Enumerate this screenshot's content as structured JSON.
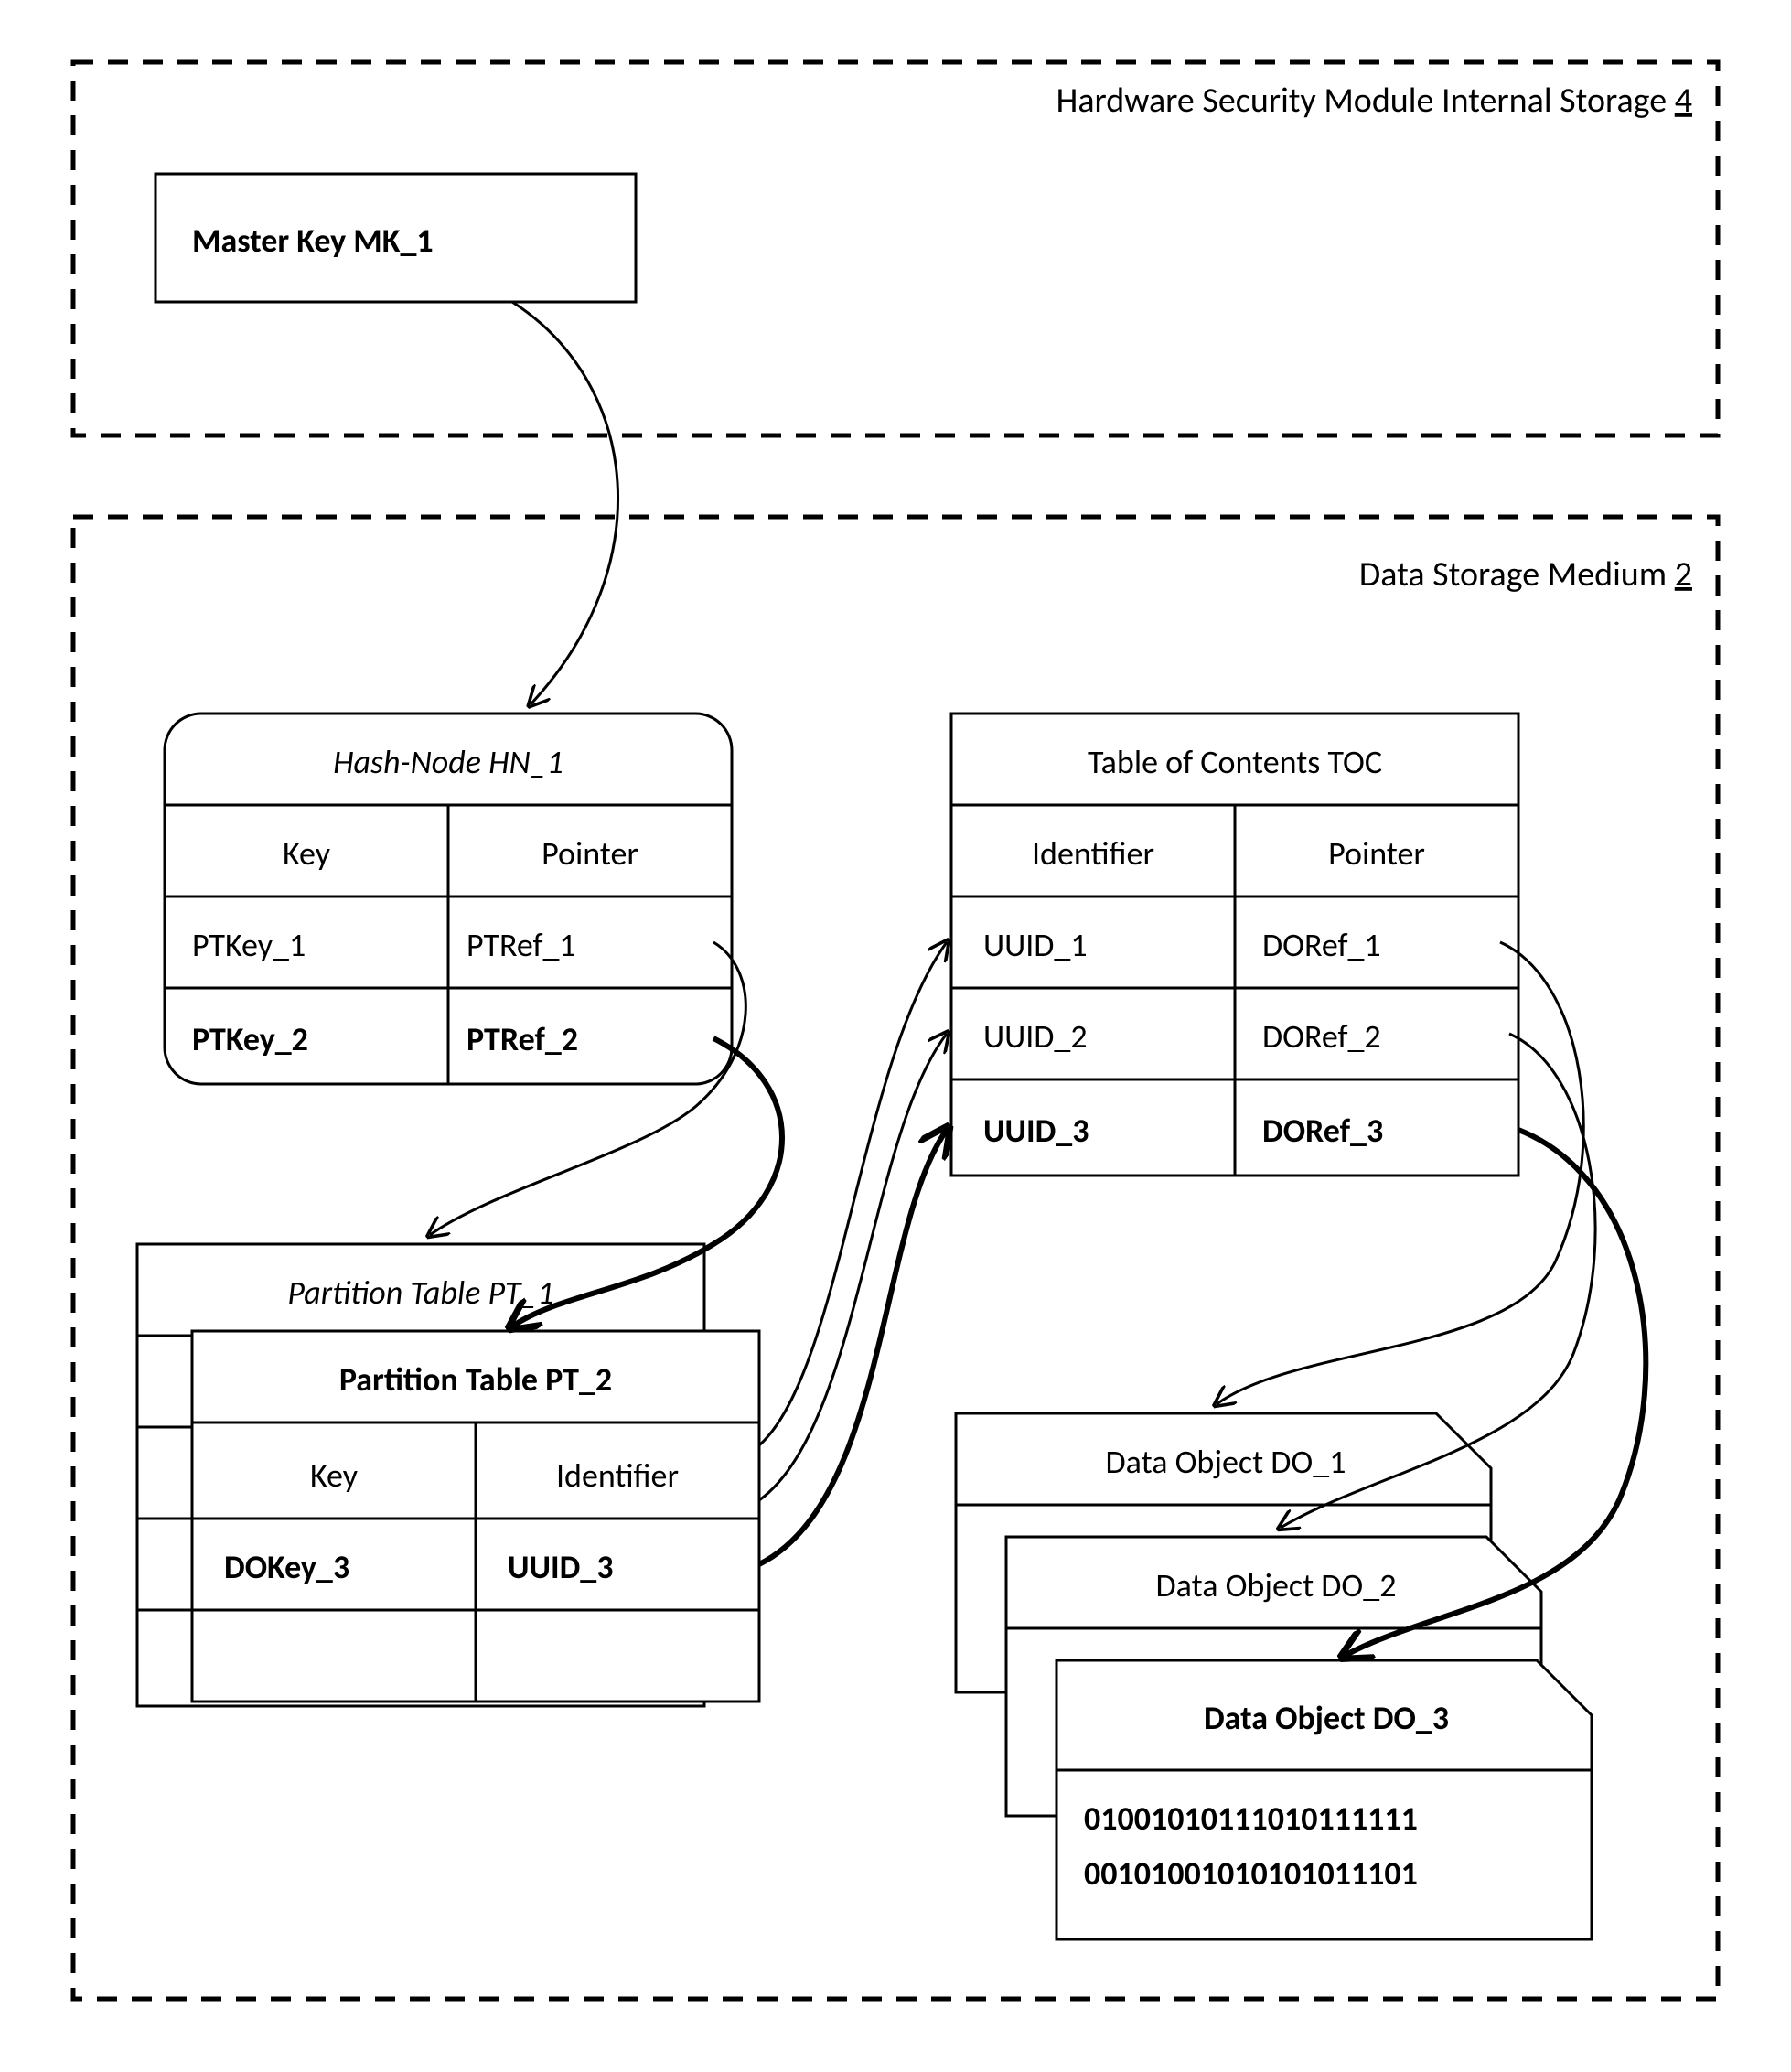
{
  "hsm": {
    "title_pre": "Hardware Security Module Internal Storage ",
    "title_num": "4",
    "master_key": "Master Key MK_1"
  },
  "dsm": {
    "title_pre": "Data Storage Medium ",
    "title_num": "2"
  },
  "hash_node": {
    "title": "Hash-Node HN_1",
    "col_key": "Key",
    "col_ptr": "Pointer",
    "rows": [
      {
        "key": "PTKey_1",
        "ptr": "PTRef_1",
        "bold": false
      },
      {
        "key": "PTKey_2",
        "ptr": "PTRef_2",
        "bold": true
      }
    ]
  },
  "toc": {
    "title": "Table of Contents TOC",
    "col_id": "Identifier",
    "col_ptr": "Pointer",
    "rows": [
      {
        "id": "UUID_1",
        "ptr": "DORef_1",
        "bold": false
      },
      {
        "id": "UUID_2",
        "ptr": "DORef_2",
        "bold": false
      },
      {
        "id": "UUID_3",
        "ptr": "DORef_3",
        "bold": true
      }
    ]
  },
  "pt1": {
    "title": "Partition Table PT_1"
  },
  "pt2": {
    "title": "Partition Table PT_2",
    "col_key": "Key",
    "col_id": "Identifier",
    "row": {
      "key": "DOKey_3",
      "id": "UUID_3"
    }
  },
  "do1": {
    "title": "Data Object DO_1"
  },
  "do2": {
    "title": "Data Object DO_2"
  },
  "do3": {
    "title": "Data Object DO_3",
    "bits1": "01001010111010111111",
    "bits2": "00101001010101011101"
  }
}
